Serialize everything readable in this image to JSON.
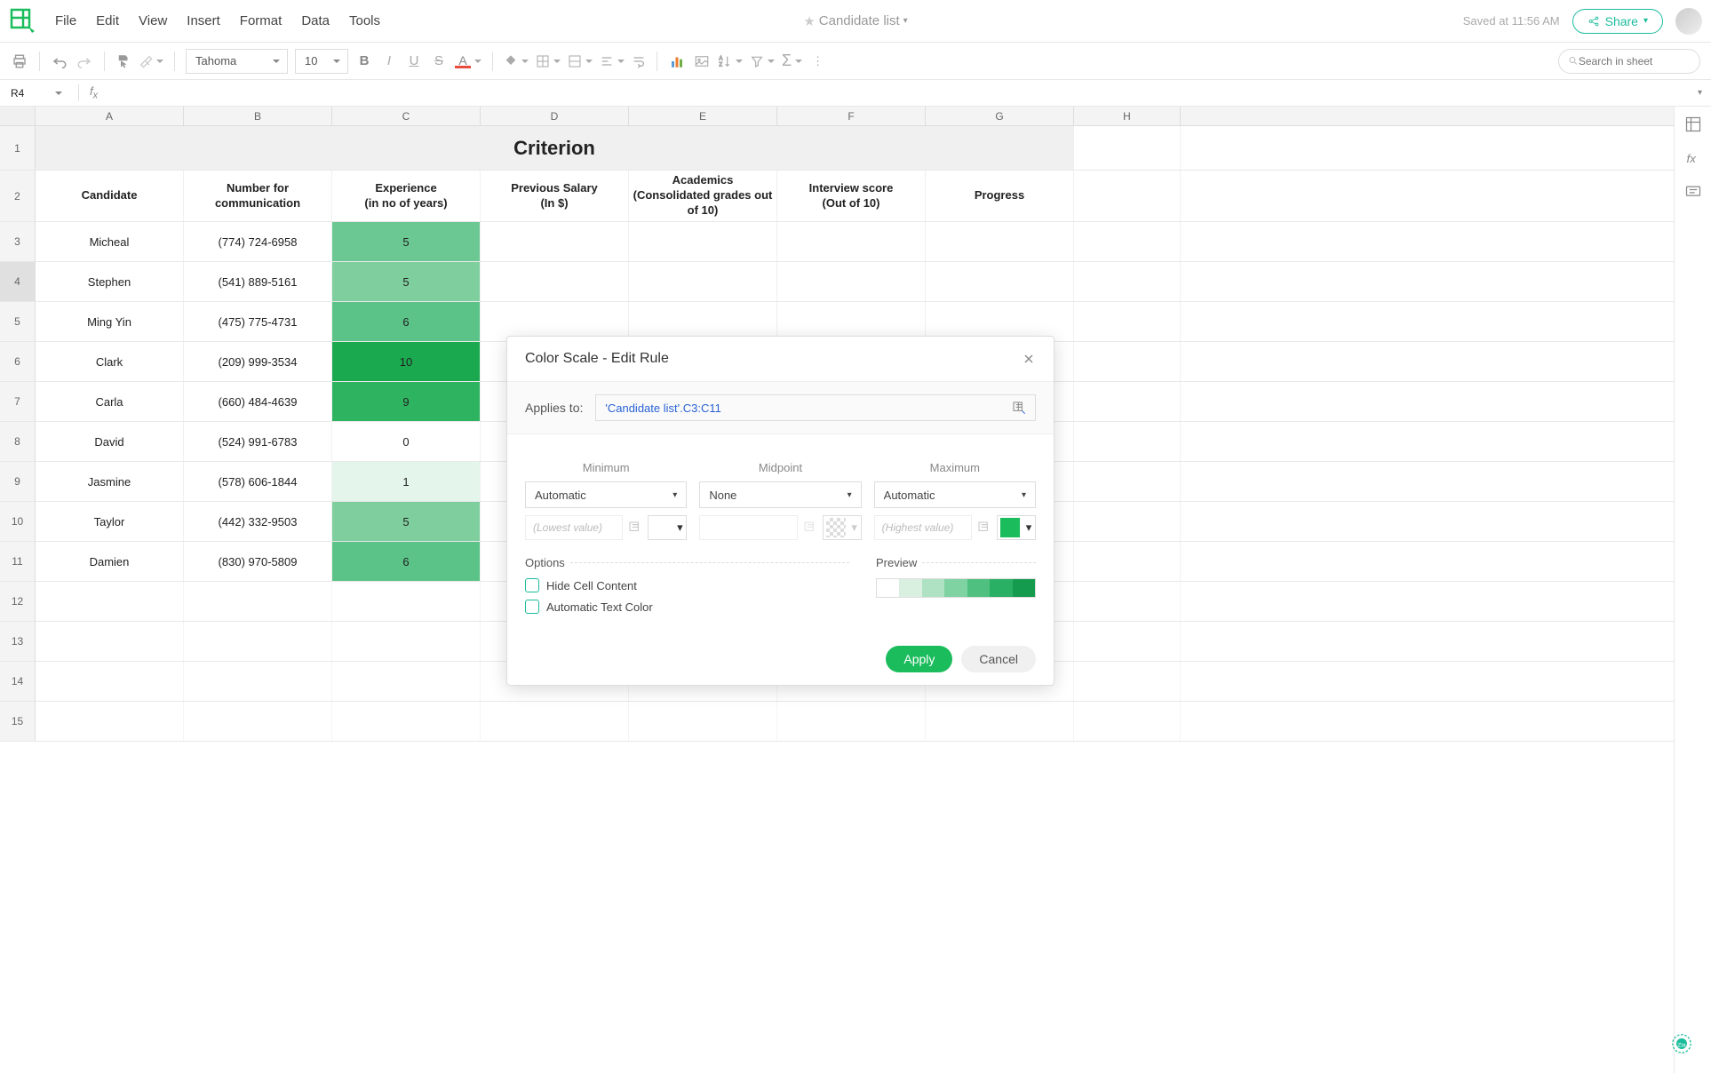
{
  "doc_title": "Candidate list",
  "menus": [
    "File",
    "Edit",
    "View",
    "Insert",
    "Format",
    "Data",
    "Tools"
  ],
  "saved_text": "Saved at 11:56 AM",
  "share_label": "Share",
  "font_name": "Tahoma",
  "font_size": "10",
  "cell_ref": "R4",
  "search_placeholder": "Search in sheet",
  "columns": [
    "A",
    "B",
    "C",
    "D",
    "E",
    "F",
    "G",
    "H"
  ],
  "row_numbers": [
    "1",
    "2",
    "3",
    "4",
    "5",
    "6",
    "7",
    "8",
    "9",
    "10",
    "11",
    "12",
    "13",
    "14",
    "15"
  ],
  "title_cell": "Criterion",
  "headers": [
    "Candidate",
    "Number for communication",
    "Experience\n(in no of years)",
    "Previous Salary\n(In $)",
    "Academics\n(Consolidated grades out of 10)",
    "Interview score\n(Out of 10)",
    "Progress"
  ],
  "rows": [
    {
      "name": "Micheal",
      "phone": "(774) 724-6958",
      "exp": "5",
      "color": "#6bc892"
    },
    {
      "name": "Stephen",
      "phone": "(541) 889-5161",
      "exp": "5",
      "color": "#7fcf9e"
    },
    {
      "name": "Ming Yin",
      "phone": "(475) 775-4731",
      "exp": "6",
      "color": "#5cc388"
    },
    {
      "name": "Clark",
      "phone": "(209) 999-3534",
      "exp": "10",
      "color": "#1aa94f"
    },
    {
      "name": "Carla",
      "phone": "(660) 484-4639",
      "exp": "9",
      "color": "#2eb461"
    },
    {
      "name": "David",
      "phone": "(524) 991-6783",
      "exp": "0",
      "color": "#ffffff"
    },
    {
      "name": "Jasmine",
      "phone": "(578) 606-1844",
      "exp": "1",
      "color": "#e4f5eb"
    },
    {
      "name": "Taylor",
      "phone": "(442) 332-9503",
      "exp": "5",
      "color": "#7fcf9e"
    },
    {
      "name": "Damien",
      "phone": "(830) 970-5809",
      "exp": "6",
      "color": "#5cc388"
    }
  ],
  "dialog": {
    "title": "Color Scale - Edit Rule",
    "applies_label": "Applies to:",
    "range": "'Candidate list'.C3:C11",
    "min_label": "Minimum",
    "mid_label": "Midpoint",
    "max_label": "Maximum",
    "auto_label": "Automatic",
    "none_label": "None",
    "lowest_placeholder": "(Lowest value)",
    "highest_placeholder": "(Highest value)",
    "options_label": "Options",
    "preview_label": "Preview",
    "opt_hide": "Hide Cell Content",
    "opt_textcolor": "Automatic Text Color",
    "apply": "Apply",
    "cancel": "Cancel",
    "preview_colors": [
      "#ffffff",
      "#d9f0e1",
      "#aee2c2",
      "#7fd2a1",
      "#4fc080",
      "#2ab064",
      "#149b4e"
    ]
  }
}
